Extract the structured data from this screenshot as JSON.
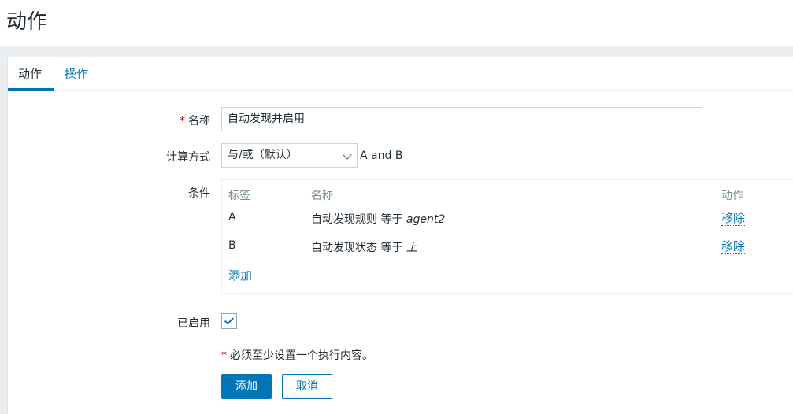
{
  "page": {
    "title": "动作"
  },
  "tabs": [
    {
      "label": "动作",
      "active": true
    },
    {
      "label": "操作",
      "active": false
    }
  ],
  "form": {
    "name": {
      "required_mark": "*",
      "label": "名称",
      "value": "自动发现并启用"
    },
    "calc": {
      "label": "计算方式",
      "selected": "与/或（默认）",
      "formula": "A and B"
    },
    "conditions": {
      "label": "条件",
      "headers": {
        "tag": "标签",
        "name": "名称",
        "action": "动作"
      },
      "rows": [
        {
          "tag": "A",
          "name_prefix": "自动发现规则 等于 ",
          "name_value": "agent2",
          "action": "移除"
        },
        {
          "tag": "B",
          "name_prefix": "自动发现状态 等于 ",
          "name_value": "上",
          "action": "移除"
        }
      ],
      "add_label": "添加"
    },
    "enabled": {
      "label": "已启用",
      "checked": true
    },
    "note": {
      "required_mark": "*",
      "text": "必须至少设置一个执行内容。"
    },
    "buttons": {
      "add": "添加",
      "cancel": "取消"
    }
  },
  "colors": {
    "accent": "#0275b8",
    "required": "#d40000",
    "muted": "#768d99"
  }
}
